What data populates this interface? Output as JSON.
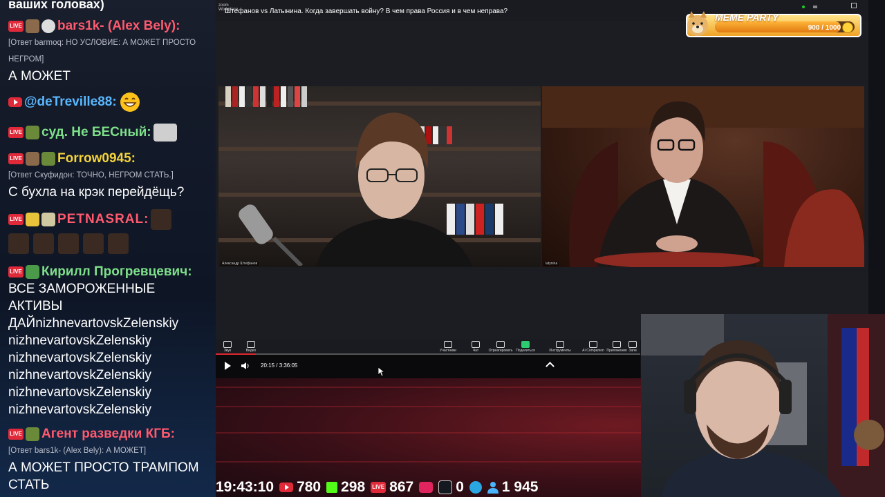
{
  "chat": {
    "top_fragment": "ваших головах)",
    "messages": [
      {
        "author": "bars1k- (Alex Bely):",
        "color": "#ff5a6e",
        "reply": "[Ответ barmoq: НО УСЛОВИЕ: А МОЖЕТ ПРОСТО",
        "reply2": "НЕГРОМ]",
        "lines": [
          "А МОЖЕТ"
        ]
      },
      {
        "author": "@deTreville88:",
        "color": "#5ab8ff",
        "lines": []
      },
      {
        "author": "суд. Не БЕСный:",
        "color": "#7ee08a",
        "lines": []
      },
      {
        "author": "Forrow0945:",
        "color": "#f4d33b",
        "reply": "[Ответ Скуфидон: ТОЧНО, НЕГРОМ СТАТЬ.]",
        "lines": [
          "С бухла на крэк перейдёщь?"
        ]
      },
      {
        "author": "PETNASRAL:",
        "color": "#ff5a6e",
        "lines": []
      },
      {
        "author": "Кирилл Прогревцевич:",
        "color": "#7ee08a",
        "lines": [
          "ВСЕ ЗАМОРОЖЕННЫЕ",
          "АКТИВЫ",
          "ДАЙnizhnevartovskZelenskiy",
          "nizhnevartovskZelenskiy",
          "nizhnevartovskZelenskiy",
          "nizhnevartovskZelenskiy",
          "nizhnevartovskZelenskiy",
          "nizhnevartovskZelenskiy"
        ]
      },
      {
        "author": "Агент разведки КГБ:",
        "color": "#ff5a6e",
        "reply": "[Ответ bars1k- (Alex Bely): А МОЖЕТ]",
        "lines": [
          "А МОЖЕТ ПРОСТО ТРАМПОМ",
          "СТАТЬ"
        ]
      }
    ],
    "badge_live": "LIVE"
  },
  "zoom": {
    "logo_line1": "zoom",
    "logo_line2": "Workplace",
    "title": "Штефанов vs Латынина. Когда завершать войну? В чем права Россия и в чем неправа?",
    "participant_left": "Александр Штефанов",
    "participant_right": "latynina",
    "toolbar": [
      {
        "label": "Звук",
        "icon": "mic-icon"
      },
      {
        "label": "Видео",
        "icon": "camera-icon"
      },
      {
        "label": "Участники",
        "icon": "participants-icon"
      },
      {
        "label": "Чат",
        "icon": "chat-icon"
      },
      {
        "label": "Отреагировать",
        "icon": "heart-icon"
      },
      {
        "label": "Поделиться",
        "icon": "share-icon"
      },
      {
        "label": "Инструменты организатора",
        "icon": "shield-icon"
      },
      {
        "label": "AI Companion",
        "icon": "sparkle-icon"
      },
      {
        "label": "Приложения",
        "icon": "apps-icon"
      },
      {
        "label": "Запи",
        "icon": "record-icon"
      }
    ]
  },
  "player": {
    "time": "20:15 / 3:36:05",
    "progress": 0.094
  },
  "meme_party": {
    "label": "MEME PARTY",
    "count": "900 / 1000",
    "progress": 0.9
  },
  "footer": {
    "clock": "19:43:10",
    "youtube": "780",
    "kick": "298",
    "live": "867",
    "rutube": "0",
    "viewers": "1 945"
  },
  "colors": {
    "accent_red": "#e02a3a",
    "kick_green": "#53fc18",
    "telegram_blue": "#2aa6e0"
  }
}
